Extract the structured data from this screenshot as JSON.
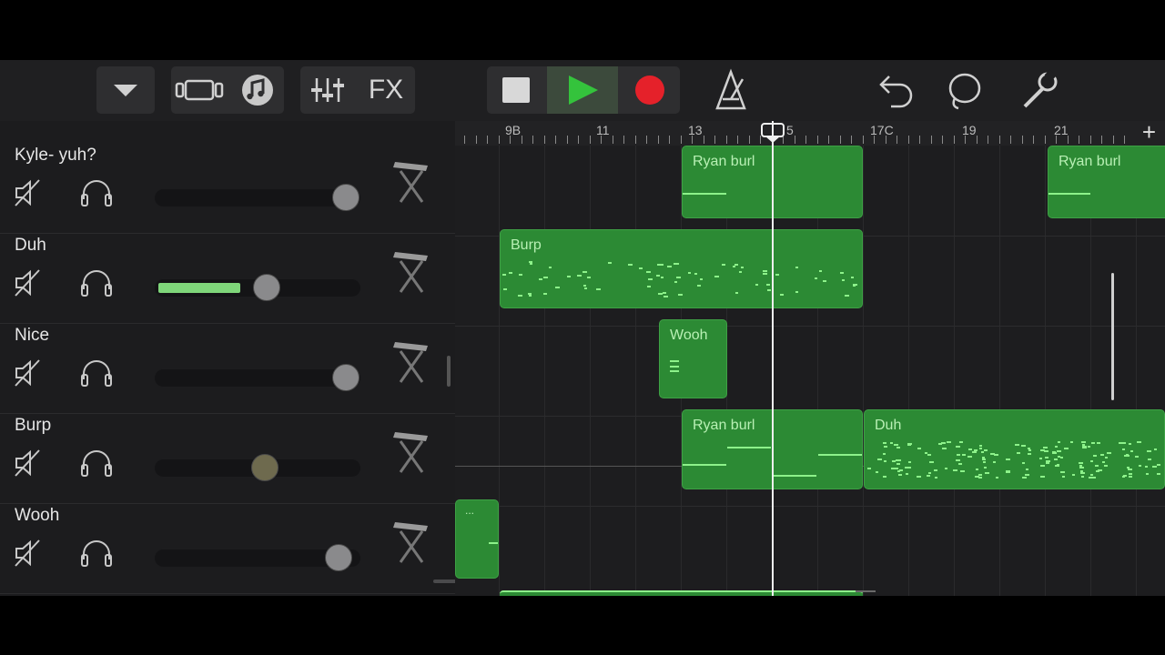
{
  "toolbar": {
    "fx_label": "FX",
    "colors": {
      "play": "#34c33c",
      "record": "#e5212a"
    }
  },
  "tracks": [
    {
      "name": "Kyle- yuh?",
      "volume": 0.97
    },
    {
      "name": "Duh",
      "volume": 0.55
    },
    {
      "name": "Nice",
      "volume": 0.97
    },
    {
      "name": "Burp",
      "volume": 0.53
    },
    {
      "name": "Wooh",
      "volume": 0.92
    }
  ],
  "ruler": {
    "bars": [
      "9B",
      "11",
      "13",
      "5",
      "17C",
      "19",
      "21"
    ],
    "add_label": "+"
  },
  "regions": [
    {
      "lane": 0,
      "label": "Ryan burl"
    },
    {
      "lane": 0,
      "label": "Ryan burl"
    },
    {
      "lane": 1,
      "label": "Burp"
    },
    {
      "lane": 2,
      "label": "Wooh"
    },
    {
      "lane": 3,
      "label": "Ryan burl"
    },
    {
      "lane": 3,
      "label": "Duh"
    },
    {
      "lane": 4,
      "label": "..."
    }
  ]
}
